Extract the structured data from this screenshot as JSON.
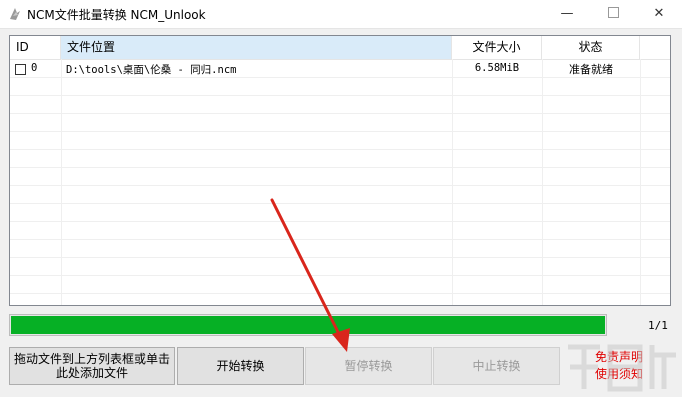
{
  "window": {
    "title": "NCM文件批量转换 NCM_Unlook",
    "minimize_glyph": "—",
    "close_glyph": "✕"
  },
  "table": {
    "columns": [
      "ID",
      "文件位置",
      "文件大小",
      "状态"
    ],
    "rows": [
      {
        "id": "0",
        "path": "D:\\tools\\桌面\\伦桑 - 同归.ncm",
        "size": "6.58MiB",
        "status": "准备就绪",
        "checked": false
      }
    ]
  },
  "progress": {
    "fraction": 1.0,
    "label": "1/1",
    "color": "#06b025"
  },
  "buttons": {
    "drag_line1": "拖动文件到上方列表框或单击",
    "drag_line2": "此处添加文件",
    "start": "开始转换",
    "pause": "暂停转换",
    "stop": "中止转换"
  },
  "disclaimer": {
    "line1": "免责声明",
    "line2": "使用须知",
    "color": "#e00000"
  },
  "annotation": {
    "arrow_color": "#d9261c"
  }
}
